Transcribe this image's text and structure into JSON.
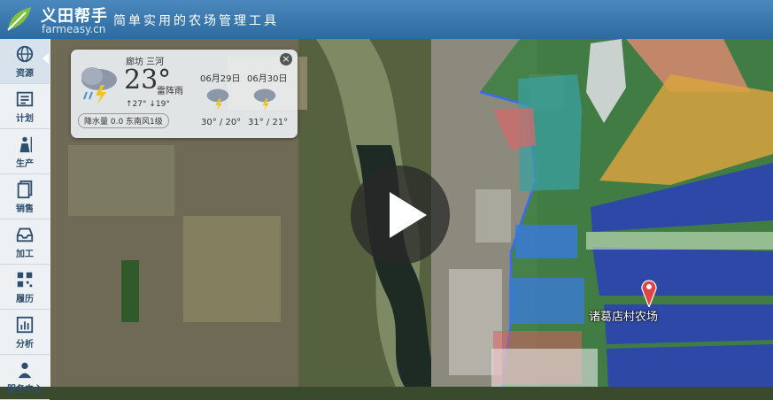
{
  "header": {
    "brand": "义田帮手",
    "domain": "farmeasy.cn",
    "slogan": "简单实用的农场管理工具"
  },
  "sidebar": {
    "items": [
      {
        "label": "资源",
        "icon": "globe-icon"
      },
      {
        "label": "计划",
        "icon": "list-icon"
      },
      {
        "label": "生产",
        "icon": "farmer-icon"
      },
      {
        "label": "销售",
        "icon": "documents-icon"
      },
      {
        "label": "加工",
        "icon": "inbox-icon"
      },
      {
        "label": "履历",
        "icon": "qr-code-icon"
      },
      {
        "label": "分析",
        "icon": "bar-chart-icon"
      },
      {
        "label": "服务中心",
        "icon": "support-person-icon"
      }
    ]
  },
  "weather": {
    "location": "廊坊 三河",
    "temp": "23°",
    "condition": "雷阵雨",
    "range": "↑27° ↓19°",
    "extra": "降水量 0.0   东南风1级",
    "forecast": [
      {
        "date": "06月29日",
        "temps": "30° / 20°"
      },
      {
        "date": "06月30日",
        "temps": "31° / 21°"
      }
    ],
    "close": "×"
  },
  "map": {
    "farm_label": "诸葛店村农场"
  }
}
